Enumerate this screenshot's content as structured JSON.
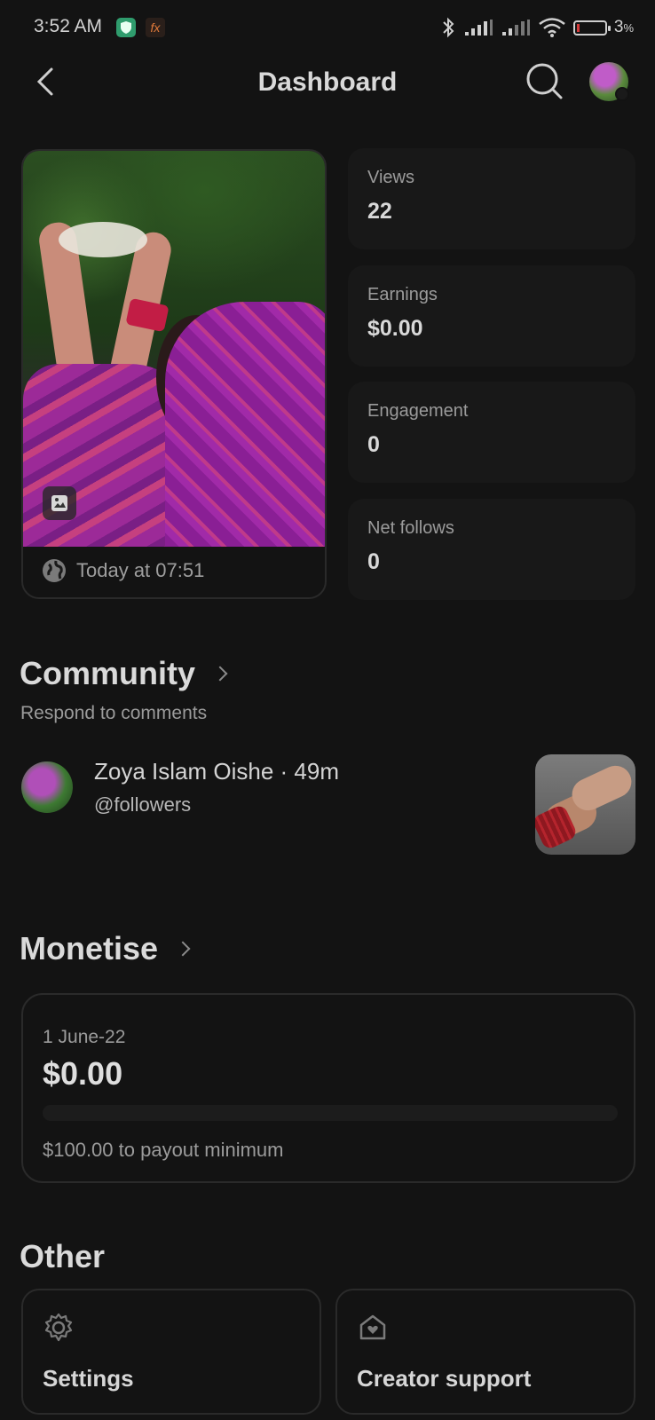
{
  "status_bar": {
    "time": "3:52 AM",
    "fx_label": "fx",
    "battery_percent": "3",
    "battery_unit": "%",
    "icons": [
      "shield-icon",
      "fx-app-icon",
      "bluetooth-icon",
      "signal-icon",
      "signal-icon",
      "wifi-icon",
      "battery-icon"
    ]
  },
  "header": {
    "title": "Dashboard",
    "back_icon": "back-arrow-icon",
    "search_icon": "search-icon",
    "avatar": "profile-avatar"
  },
  "post": {
    "date": "Today at 07:51",
    "type_icon": "image-icon",
    "visibility_icon": "globe-icon"
  },
  "stats": [
    {
      "label": "Views",
      "value": "22"
    },
    {
      "label": "Earnings",
      "value": "$0.00"
    },
    {
      "label": "Engagement",
      "value": "0"
    },
    {
      "label": "Net follows",
      "value": "0"
    }
  ],
  "community": {
    "title": "Community",
    "subtitle": "Respond to comments",
    "comment": {
      "name_time": "Zoya Islam Oishe · 49m",
      "handle": "@followers"
    }
  },
  "monetise": {
    "title": "Monetise",
    "period": "1 June-22",
    "amount": "$0.00",
    "progress": 0.0,
    "note": "$100.00 to payout minimum"
  },
  "other": {
    "title": "Other",
    "items": [
      {
        "label": "Settings",
        "icon": "gear-icon"
      },
      {
        "label": "Creator support",
        "icon": "support-heart-icon"
      }
    ]
  },
  "colors": {
    "background": "#131313",
    "card": "#181818",
    "border": "#2a2a2a",
    "text": "#d8d8d8",
    "muted": "#9b9b9b",
    "battery_low": "#d23a3a"
  }
}
